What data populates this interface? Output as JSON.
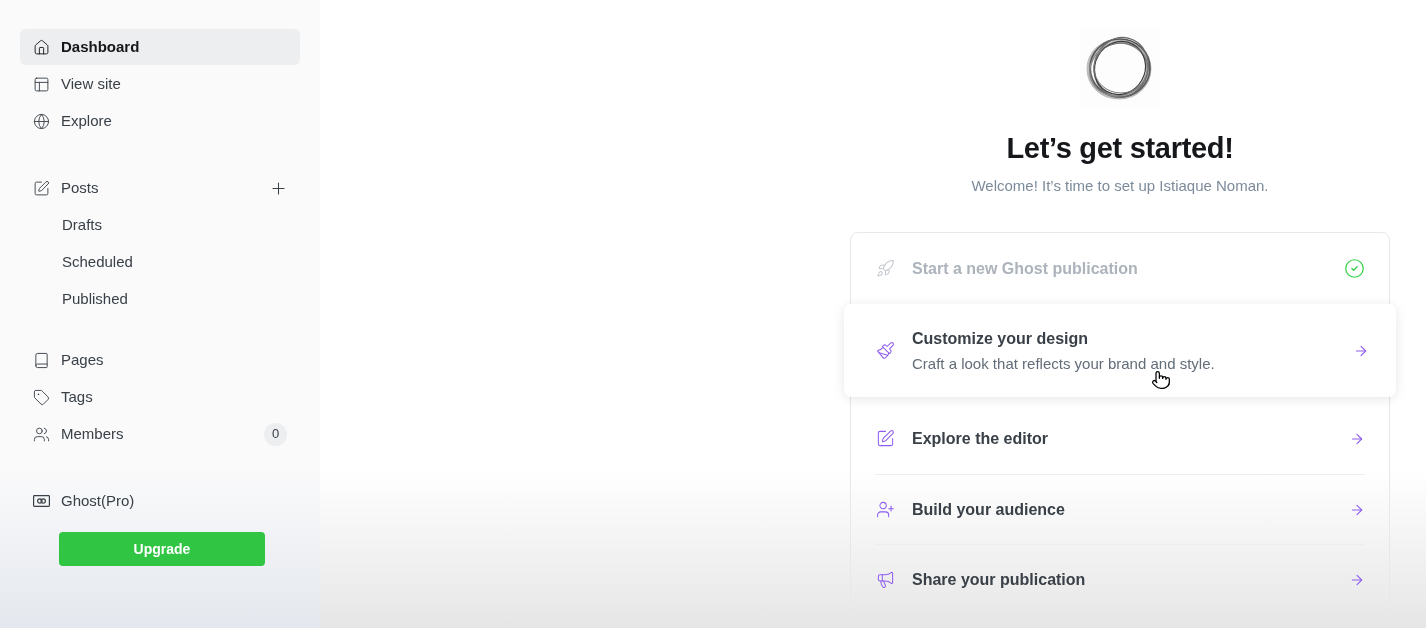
{
  "sidebar": {
    "nav": [
      {
        "label": "Dashboard",
        "selected": true
      },
      {
        "label": "View site",
        "selected": false
      },
      {
        "label": "Explore",
        "selected": false
      }
    ],
    "posts": {
      "label": "Posts",
      "selected": false,
      "children": [
        {
          "label": "Drafts",
          "selected": false
        },
        {
          "label": "Scheduled",
          "selected": false
        },
        {
          "label": "Published",
          "selected": false
        }
      ]
    },
    "library": [
      {
        "label": "Pages",
        "selected": false
      },
      {
        "label": "Tags",
        "selected": false
      },
      {
        "label": "Members",
        "selected": false,
        "badge": "0"
      }
    ],
    "plan": {
      "label": "Ghost(Pro)",
      "button": "Upgrade"
    }
  },
  "main": {
    "title": "Let’s get started!",
    "subtitle": "Welcome! It’s time to set up Istiaque Noman.",
    "steps": [
      {
        "title": "Start a new Ghost publication",
        "completed": true,
        "hovered": false
      },
      {
        "title": "Customize your design",
        "description": "Craft a look that reflects your brand and style.",
        "completed": false,
        "hovered": true
      },
      {
        "title": "Explore the editor",
        "completed": false,
        "hovered": false
      },
      {
        "title": "Build your audience",
        "completed": false,
        "hovered": false
      },
      {
        "title": "Share your publication",
        "completed": false,
        "hovered": false
      }
    ]
  }
}
